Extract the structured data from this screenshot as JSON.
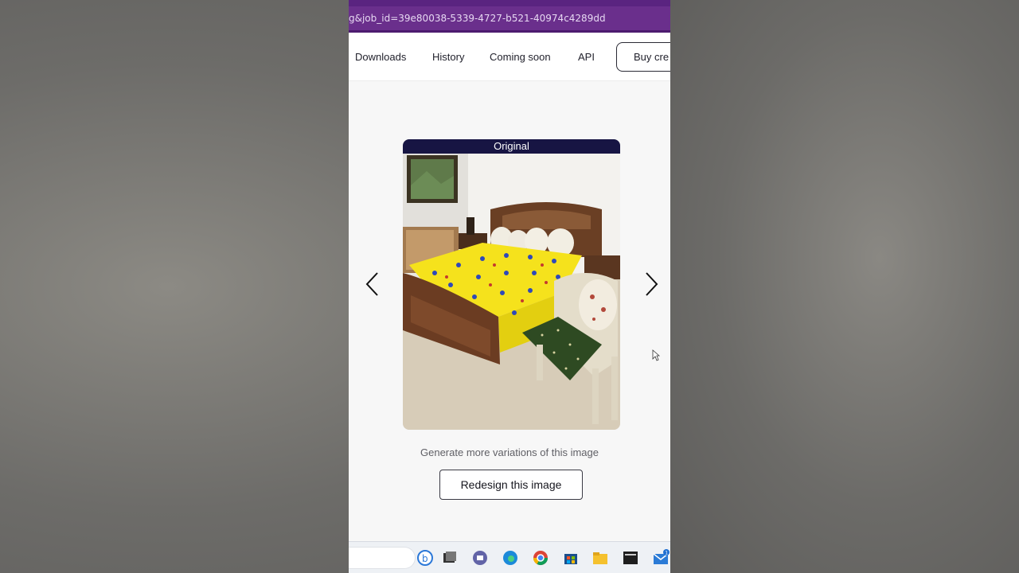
{
  "browser": {
    "url_fragment": "g&job_id=39e80038-5339-4727-b521-40974c4289dd"
  },
  "nav": {
    "items": [
      "Downloads",
      "History",
      "Coming soon",
      "API"
    ],
    "buy_label": "Buy cre"
  },
  "card": {
    "label": "Original"
  },
  "actions": {
    "caption": "Generate more variations of this image",
    "redesign_label": "Redesign this image"
  },
  "taskbar": {
    "icons": [
      "bing-icon",
      "task-view-icon",
      "teams-chat-icon",
      "edge-icon",
      "chrome-icon",
      "store-icon",
      "file-explorer-icon",
      "terminal-icon",
      "mail-icon"
    ],
    "mail_badge": "1"
  },
  "colors": {
    "url_bar": "#6a2f8c",
    "label_bg": "#171543",
    "bedspread": "#f5e21c"
  }
}
